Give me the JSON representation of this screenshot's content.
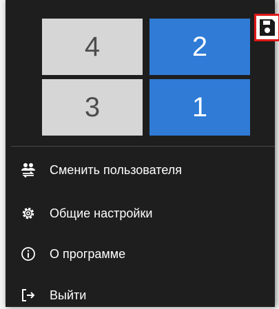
{
  "layout_tiles": [
    {
      "label": "4",
      "style": "light"
    },
    {
      "label": "2",
      "style": "blue"
    },
    {
      "label": "3",
      "style": "light"
    },
    {
      "label": "1",
      "style": "blue"
    }
  ],
  "menu": {
    "switch_user": {
      "label": "Сменить пользователя",
      "icon": "switch-user-icon"
    },
    "settings": {
      "label": "Общие настройки",
      "icon": "gear-icon"
    },
    "about": {
      "label": "О программе",
      "icon": "info-icon"
    },
    "exit": {
      "label": "Выйти",
      "icon": "exit-icon"
    }
  },
  "save_button": {
    "icon": "floppy-disk-icon",
    "highlight_color": "#e01818"
  },
  "colors": {
    "background": "#1e1e1e",
    "tile_light": "#d6d6d6",
    "tile_blue": "#2f7bd6"
  }
}
